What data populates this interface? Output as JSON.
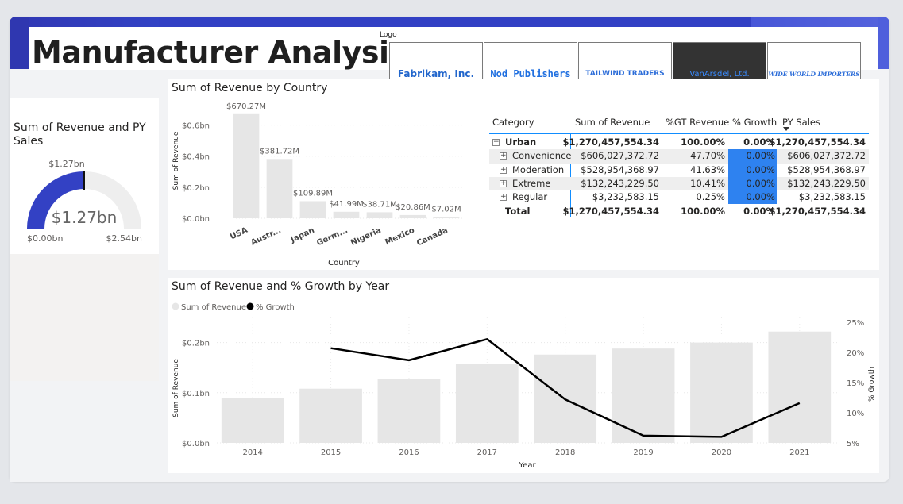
{
  "page": {
    "title": "Manufacturer Analysis"
  },
  "logos": {
    "label": "Logo",
    "items": [
      "Fabrikam, Inc.",
      "Nod Publishers",
      "TAILWIND TRADERS",
      "VanArsdel, Ltd.",
      "Wide World Importers"
    ]
  },
  "gauge": {
    "title_line1": "Sum of Revenue and PY",
    "title_line2": "Sales",
    "value_label": "$1.27bn",
    "target_label": "$1.27bn",
    "min_label": "$0.00bn",
    "max_label": "$2.54bn",
    "value": 1.27,
    "min": 0,
    "max": 2.54,
    "colors": {
      "fill": "#3341c4",
      "track": "#eeeeee"
    }
  },
  "country_chart": {
    "title": "Sum of Revenue by Country",
    "chart_data": {
      "type": "bar",
      "categories": [
        "USA",
        "Austr...",
        "Japan",
        "Germ...",
        "Nigeria",
        "Mexico",
        "Canada"
      ],
      "values": [
        670.27,
        381.72,
        109.89,
        41.99,
        38.71,
        20.86,
        7.02
      ],
      "data_labels": [
        "$670.27M",
        "$381.72M",
        "$109.89M",
        "$41.99M",
        "$38.71M",
        "$20.86M",
        "$7.02M"
      ],
      "xlabel": "Country",
      "ylabel": "Sum of Revenue",
      "yticks": [
        "$0.0bn",
        "$0.2bn",
        "$0.4bn",
        "$0.6bn"
      ],
      "ylim": [
        0,
        0.7
      ],
      "bar_color": "#e6e6e6"
    }
  },
  "matrix": {
    "headers": [
      "Category",
      "Sum of Revenue",
      "%GT Revenue",
      "% Growth",
      "PY Sales"
    ],
    "sort_icon": "sort-down-icon",
    "rows": [
      {
        "name": "Urban",
        "revenue": "$1,270,457,554.34",
        "gt": "100.00%",
        "growth": "0.00%",
        "py": "$1,270,457,554.34",
        "level": 0
      },
      {
        "name": "Convenience",
        "revenue": "$606,027,372.72",
        "gt": "47.70%",
        "growth": "0.00%",
        "py": "$606,027,372.72",
        "level": 1
      },
      {
        "name": "Moderation",
        "revenue": "$528,954,368.97",
        "gt": "41.63%",
        "growth": "0.00%",
        "py": "$528,954,368.97",
        "level": 1
      },
      {
        "name": "Extreme",
        "revenue": "$132,243,229.50",
        "gt": "10.41%",
        "growth": "0.00%",
        "py": "$132,243,229.50",
        "level": 1
      },
      {
        "name": "Regular",
        "revenue": "$3,232,583.15",
        "gt": "0.25%",
        "growth": "0.00%",
        "py": "$3,232,583.15",
        "level": 1
      }
    ],
    "total": {
      "name": "Total",
      "revenue": "$1,270,457,554.34",
      "gt": "100.00%",
      "growth": "0.00%",
      "py": "$1,270,457,554.34"
    },
    "highlight_color": "#2e82f0"
  },
  "year_chart": {
    "title": "Sum of Revenue and % Growth by Year",
    "legend": [
      "Sum of Revenue",
      "% Growth"
    ],
    "chart_data": {
      "type": "bar",
      "categories": [
        "2014",
        "2015",
        "2016",
        "2017",
        "2018",
        "2019",
        "2020",
        "2021"
      ],
      "series": [
        {
          "name": "Sum of Revenue",
          "type": "bar",
          "values": [
            0.09,
            0.108,
            0.128,
            0.158,
            0.176,
            0.188,
            0.2,
            0.222
          ]
        },
        {
          "name": "% Growth",
          "type": "line",
          "values": [
            null,
            20.7,
            18.7,
            22.2,
            12.2,
            6.2,
            6.0,
            11.6
          ]
        }
      ],
      "xlabel": "Year",
      "ylabel": "Sum of Revenue",
      "y2label": "% Growth",
      "yticks": [
        "$0.0bn",
        "$0.1bn",
        "$0.2bn"
      ],
      "ylim": [
        0,
        0.25
      ],
      "y2ticks": [
        "5%",
        "10%",
        "15%",
        "20%",
        "25%"
      ],
      "y2lim": [
        5,
        25
      ],
      "colors": {
        "bar": "#e6e6e6",
        "line": "#000000"
      }
    }
  }
}
